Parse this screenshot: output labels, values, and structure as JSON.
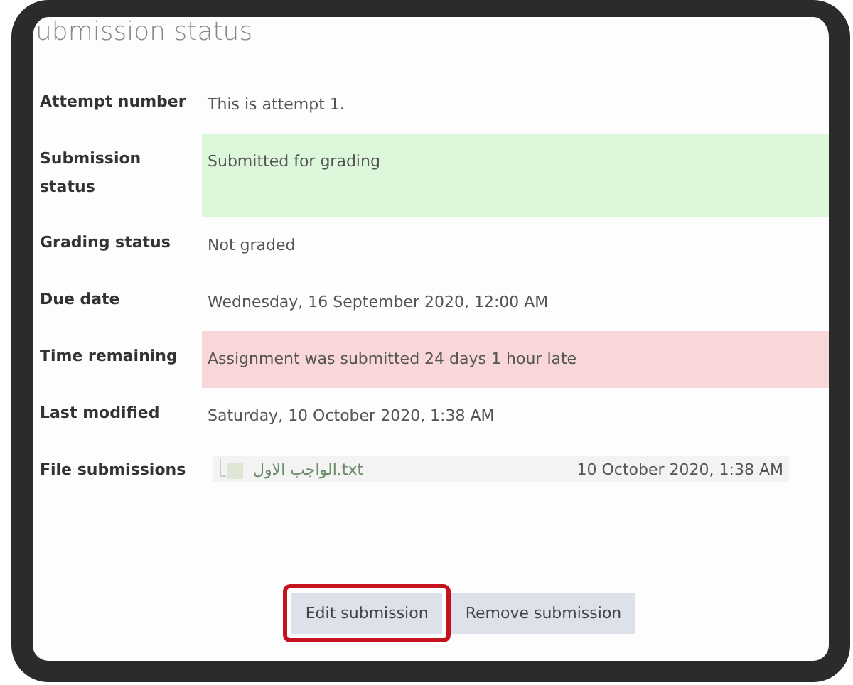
{
  "title": "ubmission status",
  "rows": [
    {
      "label": "Attempt number",
      "value": "This is attempt 1."
    },
    {
      "label": "Submission status",
      "value": "Submitted for grading",
      "color": "#dcf7da"
    },
    {
      "label": "Grading status",
      "value": "Not graded"
    },
    {
      "label": "Due date",
      "value": "Wednesday, 16 September 2020, 12:00 AM"
    },
    {
      "label": "Time remaining",
      "value": "Assignment was submitted 24 days 1 hour late",
      "color": "#f9d7d8"
    },
    {
      "label": "Last modified",
      "value": "Saturday, 10 October 2020, 1:38 AM"
    }
  ],
  "file_submissions": {
    "label": "File submissions",
    "files": [
      {
        "name": "الواجب الاول.txt",
        "date": "10 October 2020, 1:38 AM"
      }
    ]
  },
  "buttons": [
    {
      "label": "Edit submission",
      "highlighted": true
    },
    {
      "label": "Remove submission",
      "highlighted": false
    }
  ]
}
